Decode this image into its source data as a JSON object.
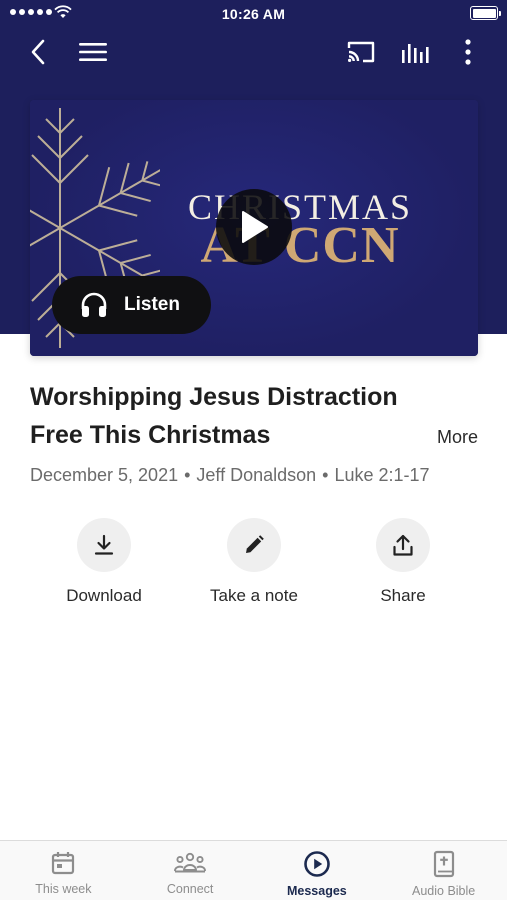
{
  "status_bar": {
    "time": "10:26 AM"
  },
  "nav": {
    "back_icon": "chevron-left-icon",
    "menu_icon": "hamburger-menu-icon",
    "cast_icon": "cast-icon",
    "audio_icon": "audio-levels-icon",
    "more_icon": "more-vertical-icon"
  },
  "artwork": {
    "title_line1": "CHRISTMAS",
    "title_line2": "AT CCN",
    "play_icon": "play-icon"
  },
  "listen": {
    "label": "Listen",
    "icon": "headphones-icon"
  },
  "message": {
    "title": "Worshipping Jesus Distraction Free This Christmas",
    "more_label": "More",
    "date": "December 5, 2021",
    "speaker": "Jeff Donaldson",
    "scripture": "Luke 2:1-17",
    "separator": "•"
  },
  "actions": [
    {
      "label": "Download",
      "icon": "download-icon"
    },
    {
      "label": "Take a note",
      "icon": "pencil-icon"
    },
    {
      "label": "Share",
      "icon": "share-icon"
    }
  ],
  "tabs": [
    {
      "label": "This week",
      "icon": "calendar-icon",
      "active": false
    },
    {
      "label": "Connect",
      "icon": "people-icon",
      "active": false
    },
    {
      "label": "Messages",
      "icon": "play-circle-icon",
      "active": true
    },
    {
      "label": "Audio Bible",
      "icon": "bible-icon",
      "active": false
    }
  ],
  "colors": {
    "header_bg": "#1d1f5c",
    "artwork_bg": "#1f2063",
    "gold": "#cfa874",
    "active_tab": "#1c2a4f"
  }
}
